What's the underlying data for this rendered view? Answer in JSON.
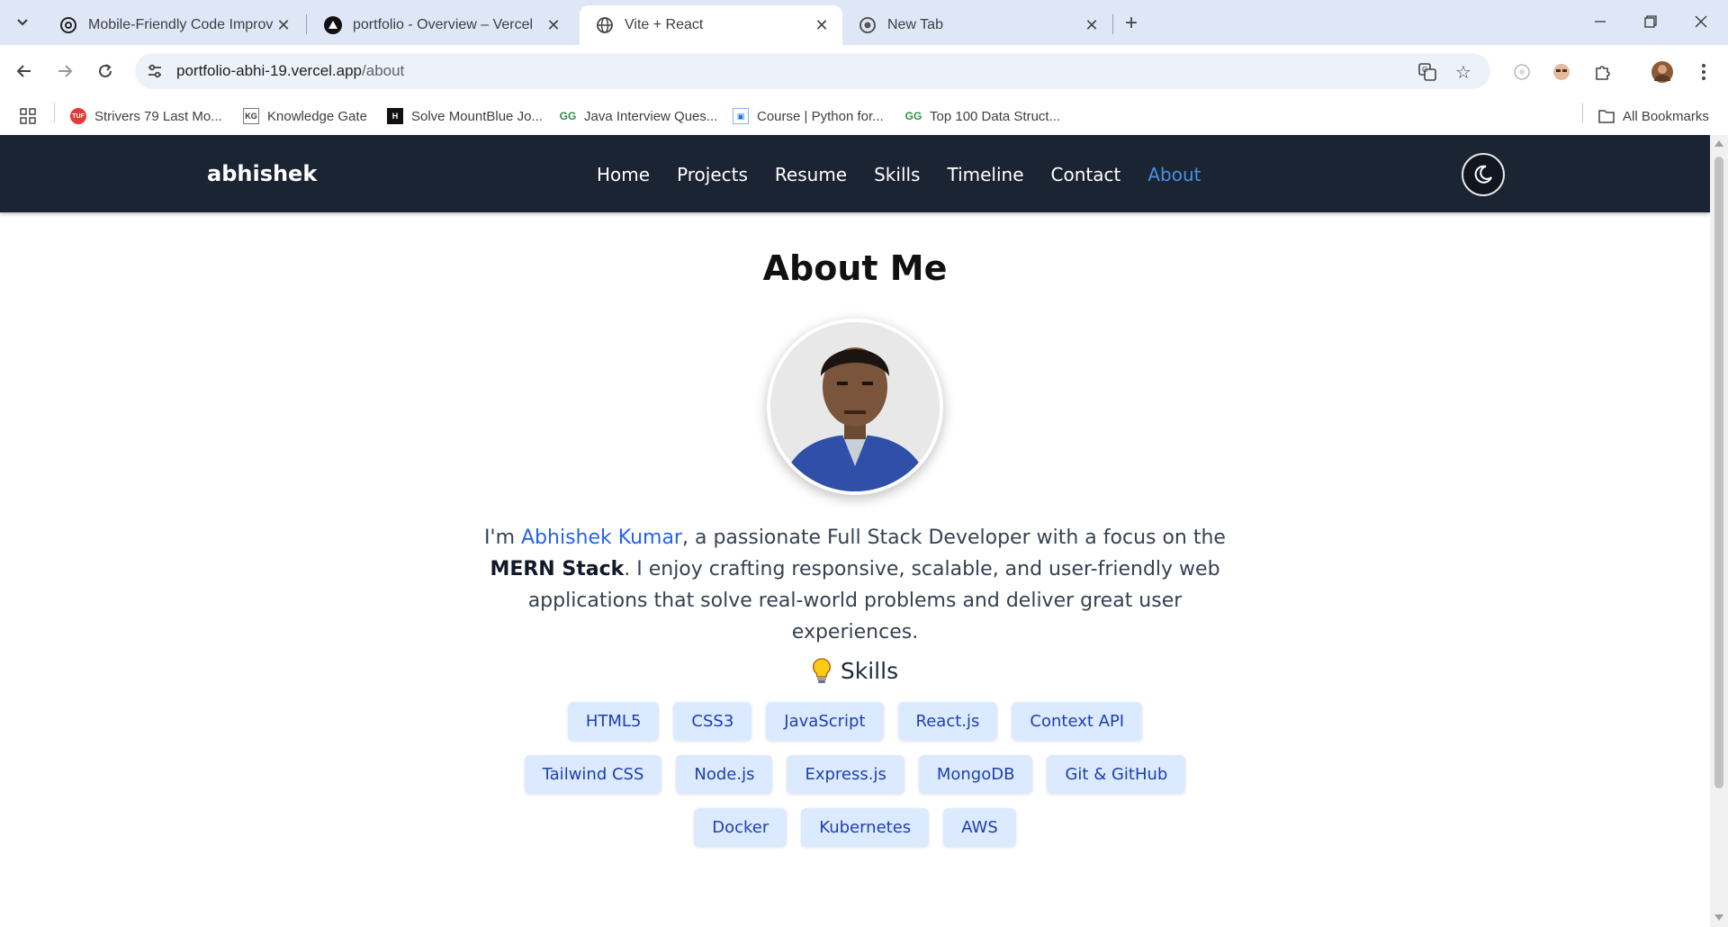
{
  "browser": {
    "tabs": [
      {
        "title": "Mobile-Friendly Code Improvem",
        "icon": "openai-icon",
        "active": false
      },
      {
        "title": "portfolio - Overview – Vercel",
        "icon": "vercel-icon",
        "active": false
      },
      {
        "title": "Vite + React",
        "icon": "globe-icon",
        "active": true
      },
      {
        "title": "New Tab",
        "icon": "chrome-icon",
        "active": false
      }
    ],
    "url_host": "portfolio-abhi-19.vercel.app",
    "url_path": "/about",
    "bookmarks": [
      {
        "label": "Strivers 79 Last Mo...",
        "icon": "tuf-icon"
      },
      {
        "label": "Knowledge Gate",
        "icon": "kg-icon"
      },
      {
        "label": "Solve MountBlue Jo...",
        "icon": "hackerearth-icon"
      },
      {
        "label": "Java Interview Ques...",
        "icon": "gfg-icon"
      },
      {
        "label": "Course | Python for...",
        "icon": "course-icon"
      },
      {
        "label": "Top 100 Data Struct...",
        "icon": "gfg-icon"
      }
    ],
    "all_bookmarks": "All Bookmarks"
  },
  "site": {
    "brand": "abhishek",
    "nav": [
      "Home",
      "Projects",
      "Resume",
      "Skills",
      "Timeline",
      "Contact",
      "About"
    ],
    "active_nav": "About"
  },
  "about": {
    "heading": "About Me",
    "intro_prefix": "I'm ",
    "intro_name": "Abhishek Kumar",
    "intro_middle": ", a passionate Full Stack Developer with a focus on the ",
    "intro_bold": "MERN Stack",
    "intro_suffix": ". I enjoy crafting responsive, scalable, and user-friendly web applications that solve real-world problems and deliver great user experiences.",
    "skills_title": "Skills",
    "skills": [
      "HTML5",
      "CSS3",
      "JavaScript",
      "React.js",
      "Context API",
      "Tailwind CSS",
      "Node.js",
      "Express.js",
      "MongoDB",
      "Git & GitHub",
      "Docker",
      "Kubernetes",
      "AWS"
    ]
  },
  "colors": {
    "nav_bg": "#1b2433",
    "active_link": "#4a90e2",
    "chip_bg": "#dbeafe",
    "chip_text": "#1e40af",
    "name_link": "#2563eb"
  }
}
